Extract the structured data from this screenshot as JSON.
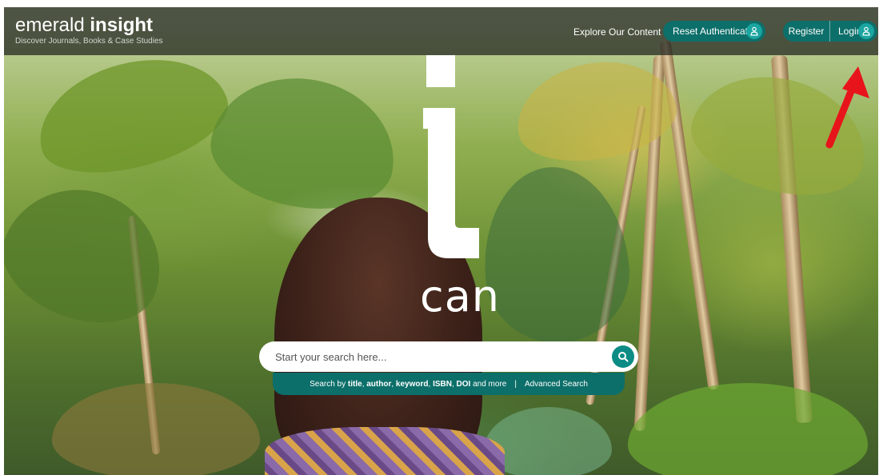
{
  "header": {
    "logo_light": "emerald",
    "logo_bold": "insight",
    "tagline": "Discover Journals, Books & Case Studies",
    "explore_label": "Explore Our Content",
    "reset_label": "Reset Authentication",
    "register_label": "Register",
    "login_label": "Login"
  },
  "hero": {
    "big_letter": "i",
    "word": "can"
  },
  "search": {
    "placeholder": "Start your search here...",
    "hint_prefix": "Search by ",
    "hint_terms": [
      "title",
      "author",
      "keyword",
      "ISBN",
      "DOI"
    ],
    "hint_suffix": " and more",
    "separator": "|",
    "advanced_label": "Advanced Search"
  },
  "colors": {
    "teal": "#0d6f6a",
    "teal_light": "#1aa5a0",
    "annotation_arrow": "#e8141b"
  },
  "icons": {
    "user": "user-icon",
    "search": "search-icon",
    "annotation": "red-arrow-annotation"
  }
}
